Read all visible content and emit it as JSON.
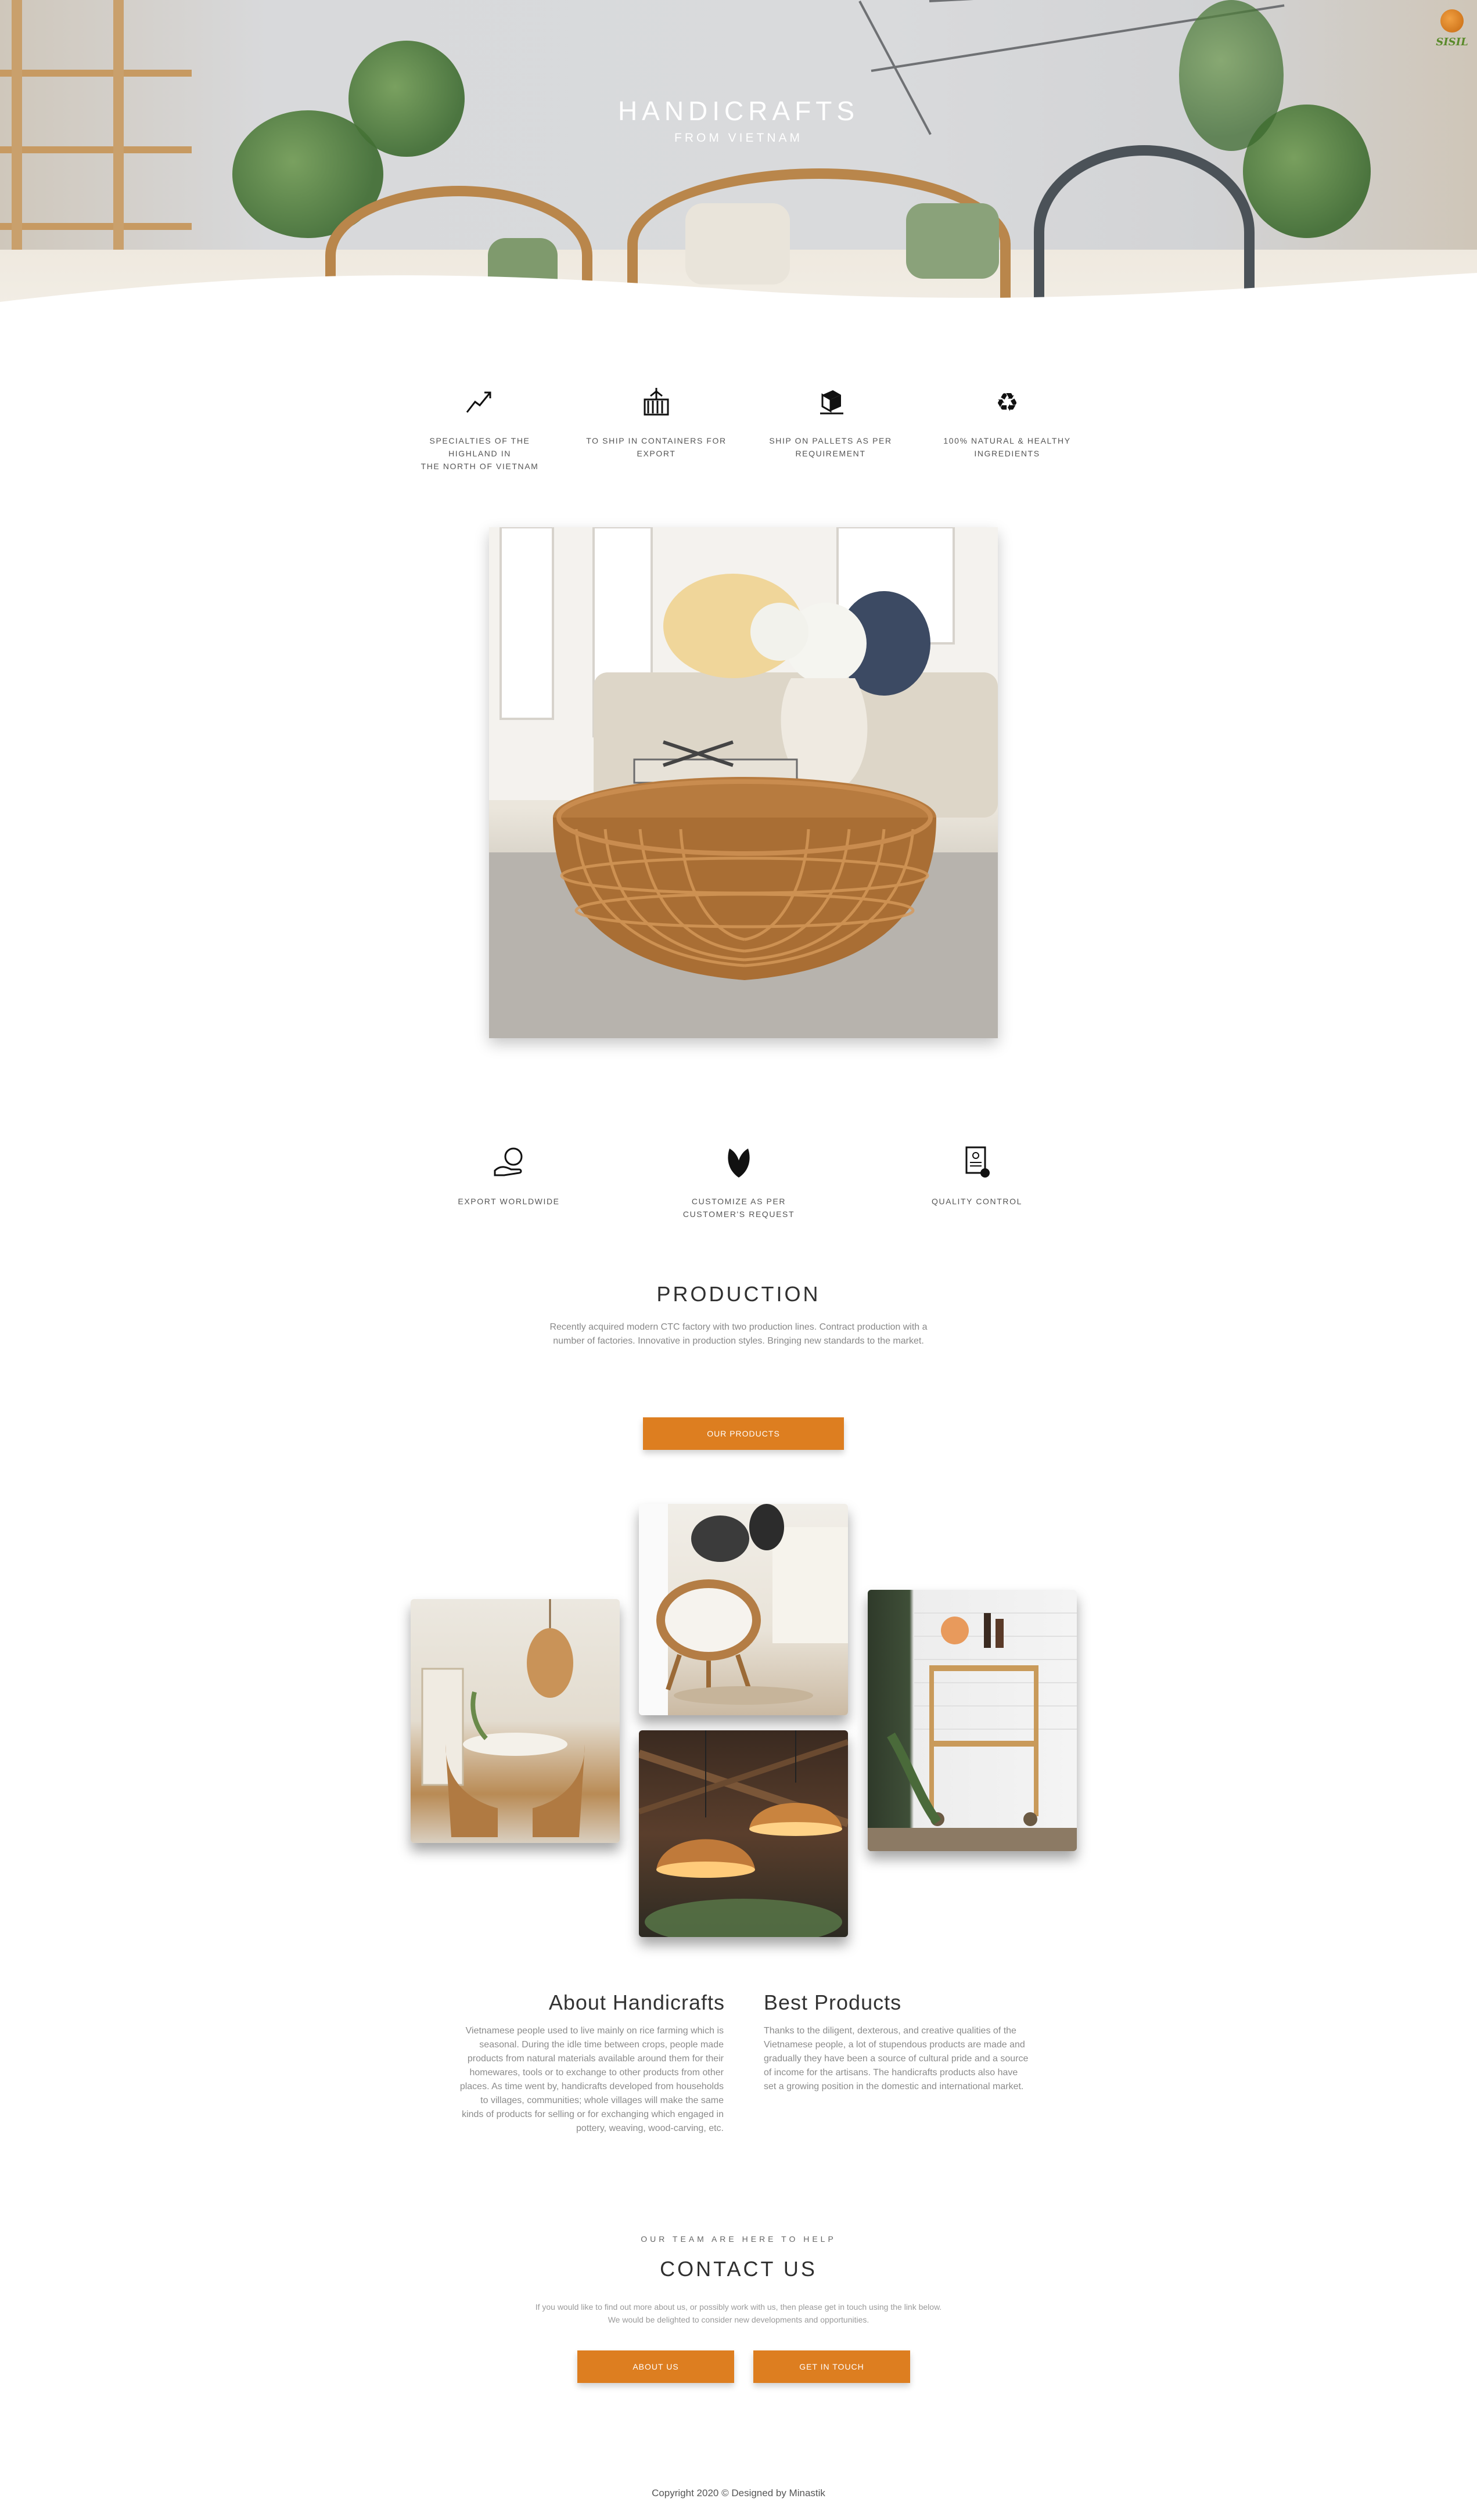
{
  "hero": {
    "title": "HANDICRAFTS",
    "subtitle": "FROM VIETNAM",
    "logo_text": "SISIL"
  },
  "features_top": [
    {
      "icon": "trend-up-icon",
      "label_lines": [
        "SPECIALTIES OF THE HIGHLAND IN",
        "THE NORTH OF VIETNAM"
      ]
    },
    {
      "icon": "container-crane-icon",
      "label_lines": [
        "TO SHIP IN CONTAINERS FOR",
        "EXPORT"
      ]
    },
    {
      "icon": "pallet-box-icon",
      "label_lines": [
        "SHIP ON PALLETS AS PER",
        "REQUIREMENT"
      ]
    },
    {
      "icon": "recycle-icon",
      "label_lines": [
        "100% NATURAL & HEALTHY",
        "INGREDIENTS"
      ]
    }
  ],
  "features_mid": [
    {
      "icon": "hand-globe-icon",
      "label": "EXPORT WORLDWIDE"
    },
    {
      "icon": "leaf-icon",
      "label": "CUSTOMIZE AS PER CUSTOMER'S REQUEST"
    },
    {
      "icon": "certificate-icon",
      "label": "QUALITY CONTROL"
    }
  ],
  "production": {
    "title": "PRODUCTION",
    "text_lines": [
      "Recently acquired modern CTC factory with two production lines. Contract production with a",
      "number of factories. Innovative in production styles. Bringing new standards to the market."
    ],
    "button": "OUR PRODUCTS"
  },
  "about": {
    "title": "About Handicrafts",
    "text_lines": [
      "Vietnamese people used to live mainly on rice farming which is",
      "seasonal. During the idle time between crops, people made",
      "products from natural materials available around them for their",
      "homewares, tools or to exchange to other products from other",
      "places. As time went by, handicrafts developed from households",
      "to villages, communities; whole villages will make the same",
      "kinds of products for selling or for exchanging which engaged in",
      "pottery, weaving, wood-carving, etc."
    ]
  },
  "best": {
    "title": "Best Products",
    "text_lines": [
      "Thanks to the diligent, dexterous, and creative qualities of the",
      "Vietnamese people, a lot of stupendous products are made and",
      "gradually they have been a source of cultural pride and a source",
      "of income for the artisans. The handicrafts products also have",
      "set a growing position in the domestic and international market."
    ]
  },
  "contact": {
    "kicker": "OUR TEAM ARE HERE TO HELP",
    "title": "CONTACT US",
    "text_lines": [
      "If you would like to find out more about us, or possibly work with us, then please get in touch using the link below.",
      "We would be delighted to consider new developments and opportunities."
    ],
    "btn_about": "ABOUT US",
    "btn_touch": "GET IN TOUCH"
  },
  "footer": {
    "copyright": "Copyright 2020 © Designed by Minastik"
  }
}
